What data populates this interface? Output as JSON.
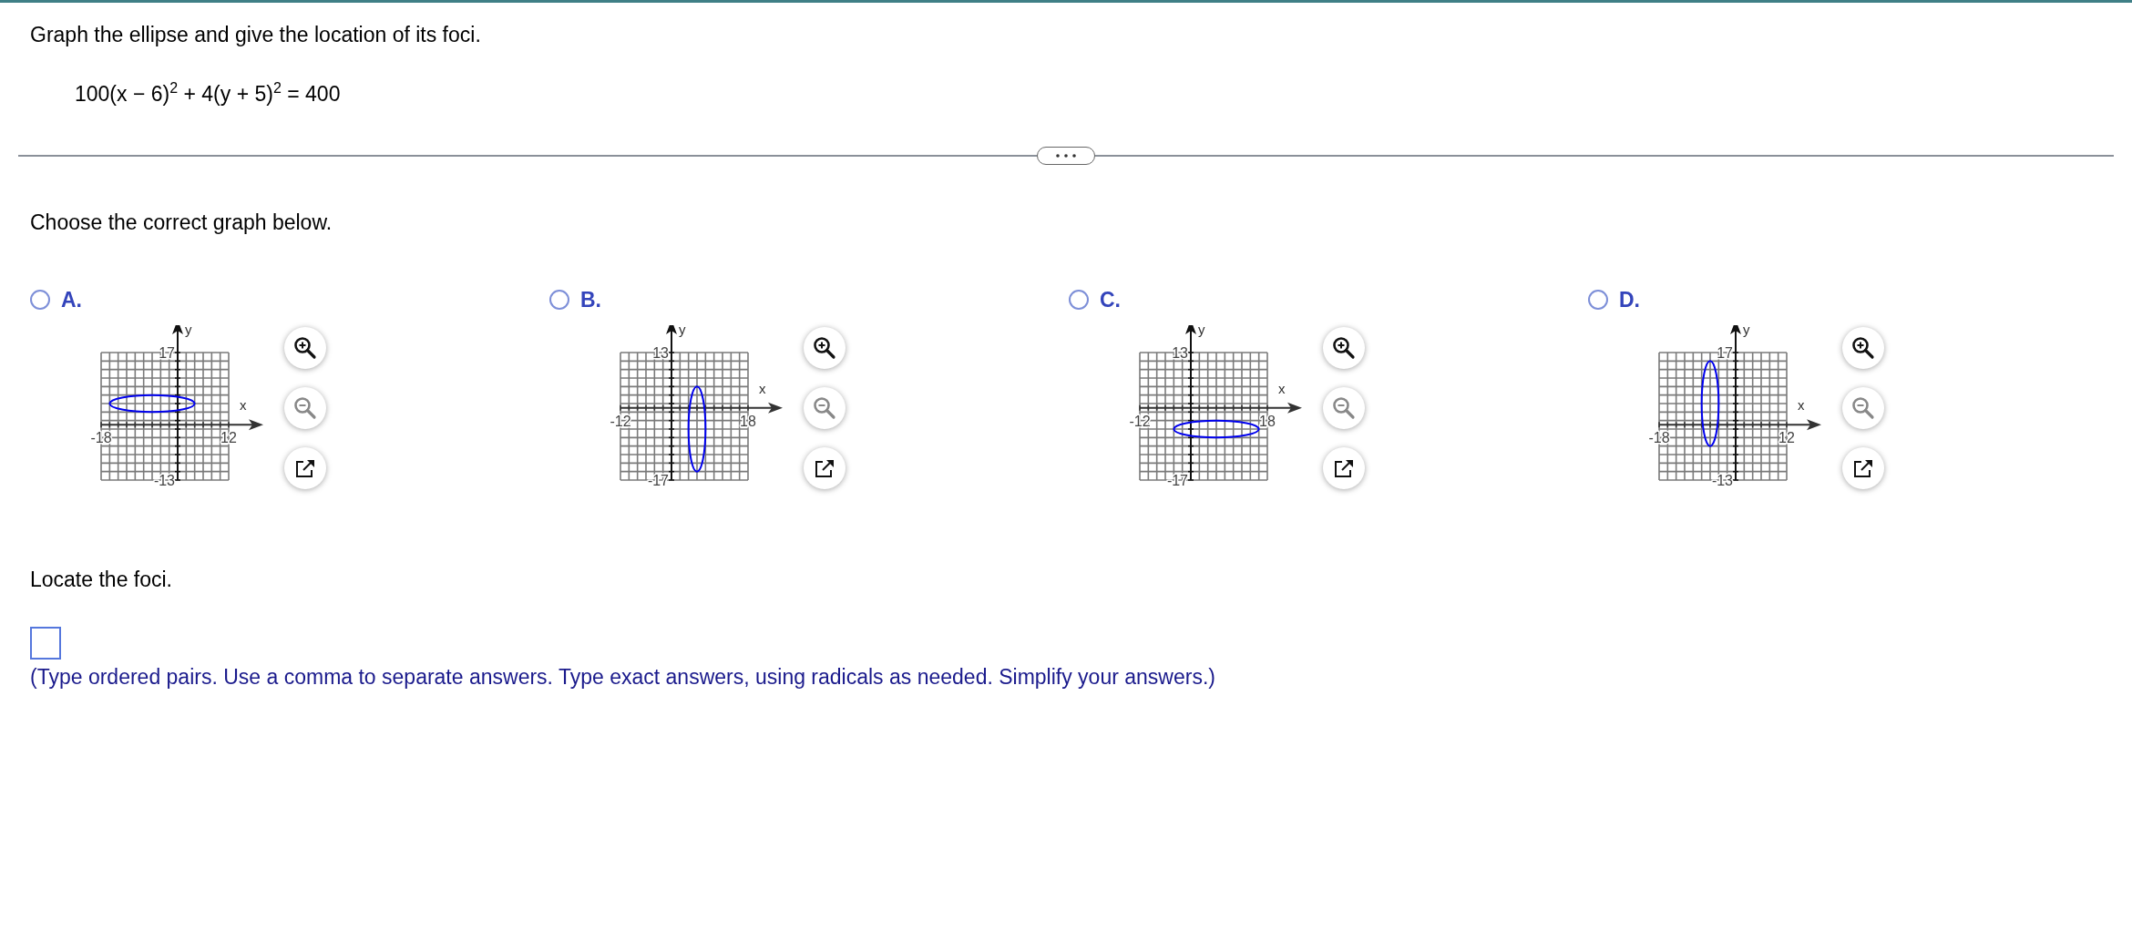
{
  "question": "Graph the ellipse and give the location of its foci.",
  "equation": "100(x − 6)$^{2}$ + 4(y + 5)$^{2}$ = 400",
  "prompt": "Choose the correct graph below.",
  "options": [
    {
      "label": "A.",
      "selected": false,
      "kind": "wide-nw",
      "chart_data": {
        "type": "line",
        "xlabel": "x",
        "ylabel": "y",
        "xlim": [
          -18,
          12
        ],
        "ylim": [
          -13,
          17
        ],
        "xticks": [
          {
            "value": -18,
            "label": "-18"
          },
          {
            "value": 12,
            "label": "12"
          }
        ],
        "yticks": [
          {
            "value": 17,
            "label": "17"
          },
          {
            "value": -13,
            "label": "-13"
          }
        ]
      }
    },
    {
      "label": "B.",
      "selected": false,
      "kind": "tall-se",
      "chart_data": {
        "type": "line",
        "xlabel": "x",
        "ylabel": "y",
        "xlim": [
          -12,
          18
        ],
        "ylim": [
          -17,
          13
        ],
        "xticks": [
          {
            "value": -12,
            "label": "-12"
          },
          {
            "value": 18,
            "label": "18"
          }
        ],
        "yticks": [
          {
            "value": 13,
            "label": "13"
          },
          {
            "value": -17,
            "label": "-17"
          }
        ]
      }
    },
    {
      "label": "C.",
      "selected": false,
      "kind": "wide-se",
      "chart_data": {
        "type": "line",
        "xlabel": "x",
        "ylabel": "y",
        "xlim": [
          -12,
          18
        ],
        "ylim": [
          -17,
          13
        ],
        "xticks": [
          {
            "value": -12,
            "label": "-12"
          },
          {
            "value": 18,
            "label": "18"
          }
        ],
        "yticks": [
          {
            "value": 13,
            "label": "13"
          },
          {
            "value": -17,
            "label": "-17"
          }
        ]
      }
    },
    {
      "label": "D.",
      "selected": false,
      "kind": "tall-nw",
      "chart_data": {
        "type": "line",
        "xlabel": "x",
        "ylabel": "y",
        "xlim": [
          -18,
          12
        ],
        "ylim": [
          -13,
          17
        ],
        "xticks": [
          {
            "value": -18,
            "label": "-18"
          },
          {
            "value": 12,
            "label": "12"
          }
        ],
        "yticks": [
          {
            "value": 17,
            "label": "17"
          },
          {
            "value": -13,
            "label": "-13"
          }
        ]
      }
    }
  ],
  "foci_prompt": "Locate the foci.",
  "instruction": "(Type ordered pairs. Use a comma to separate answers. Type exact answers, using radicals as needed. Simplify your answers.)"
}
